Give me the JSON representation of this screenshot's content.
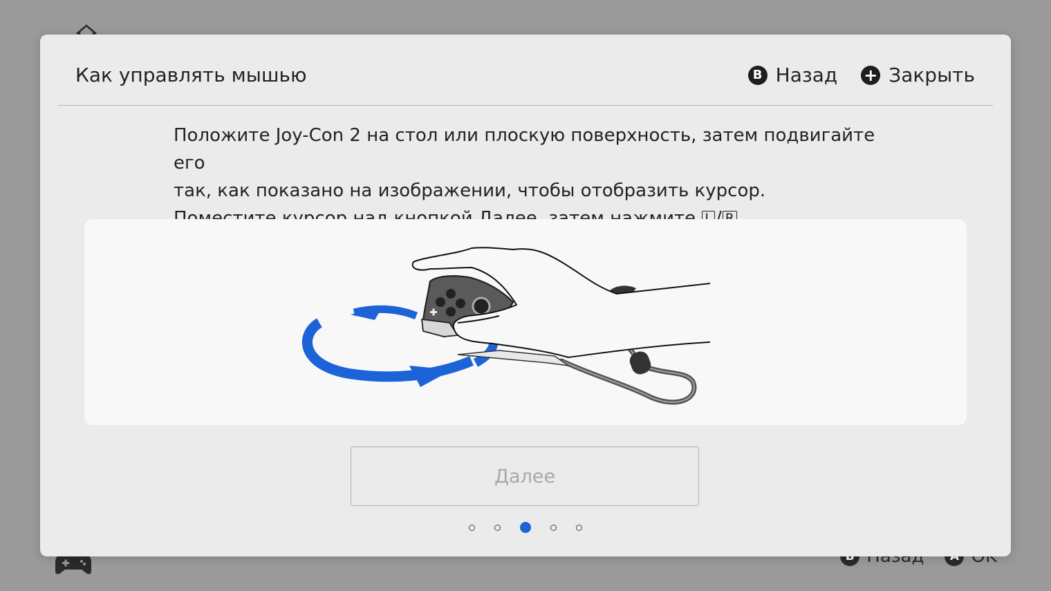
{
  "background": {
    "footer": [
      {
        "icon": "B",
        "label": "Назад"
      },
      {
        "icon": "A",
        "label": "OK"
      }
    ]
  },
  "dialog": {
    "title": "Как управлять мышью",
    "actions": {
      "back": {
        "icon": "B",
        "label": "Назад"
      },
      "close": {
        "icon": "+",
        "label": "Закрыть"
      }
    },
    "instructions": {
      "line1": "Положите Joy-Con 2 на стол или плоскую поверхность, затем подвигайте его",
      "line2": "так, как показано на изображении, чтобы отобразить курсор.",
      "line3_prefix": "Поместите курсор над кнопкой Далее, затем нажмите ",
      "key_l": "L",
      "separator": "/",
      "key_r": "R",
      "line3_suffix": "."
    },
    "next_button_label": "Далее",
    "pager": {
      "count": 5,
      "active_index": 2
    }
  },
  "colors": {
    "accent_blue": "#1c63d8",
    "dialog_bg": "#ebebeb",
    "overlay_bg": "#9a9a9a"
  },
  "icons": {
    "home": "home-icon",
    "controller": "controller-icon",
    "rotation_arrows": "rotate-arrows-icon"
  }
}
